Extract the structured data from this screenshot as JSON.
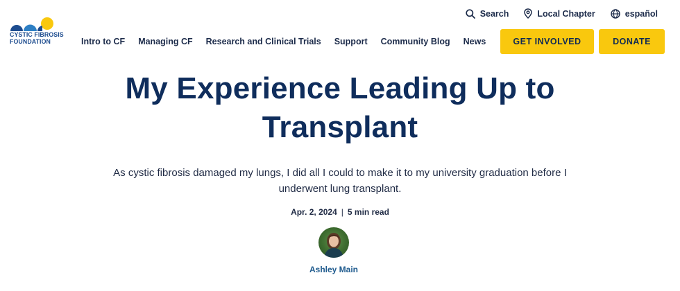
{
  "brand": {
    "line1": "CYSTIC FIBROSIS",
    "line2": "FOUNDATION",
    "colors": {
      "navy": "#0f2d5c",
      "blue": "#1d4c8f",
      "yellow": "#f9c80e"
    }
  },
  "utility": {
    "search": {
      "label": "Search",
      "icon": "search-icon"
    },
    "chapter": {
      "label": "Local Chapter",
      "icon": "location-pin-icon"
    },
    "language": {
      "label": "español",
      "icon": "globe-icon"
    }
  },
  "nav": [
    {
      "label": "Intro to CF"
    },
    {
      "label": "Managing CF"
    },
    {
      "label": "Research and Clinical Trials"
    },
    {
      "label": "Support"
    },
    {
      "label": "Community Blog"
    },
    {
      "label": "News"
    }
  ],
  "cta": {
    "involved": "GET INVOLVED",
    "donate": "DONATE"
  },
  "article": {
    "title_line1": "My Experience Leading Up to",
    "title_line2": "Transplant",
    "subtitle": "As cystic fibrosis damaged my lungs, I did all I could to make it to my university graduation before I underwent lung transplant.",
    "date": "Apr. 2, 2024",
    "separator": "|",
    "read_time": "5 min read",
    "author": "Ashley Main"
  }
}
